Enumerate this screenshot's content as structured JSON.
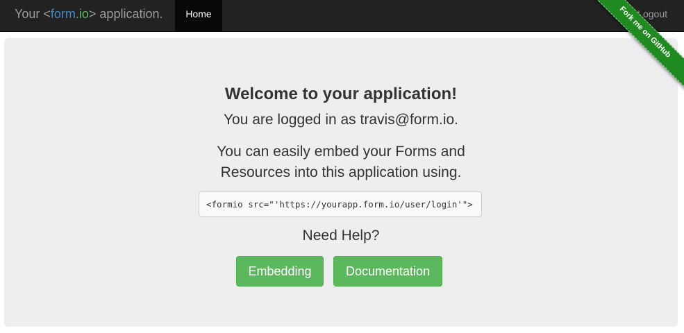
{
  "navbar": {
    "brand_prefix": "Your <",
    "brand_form": "form",
    "brand_io": ".io",
    "brand_suffix": "> application.",
    "home_label": "Home",
    "logout_label": "Logout"
  },
  "ribbon": {
    "label": "Fork me on GitHub"
  },
  "main": {
    "title": "Welcome to your application!",
    "logged_in_text": "You are logged in as travis@form.io.",
    "embed_line1": "You can easily embed your Forms and",
    "embed_line2": "Resources into this application using.",
    "code_snippet": "<formio src=\"'https://yourapp.form.io/user/login'\">",
    "need_help": "Need Help?",
    "embedding_button": "Embedding",
    "documentation_button": "Documentation"
  },
  "colors": {
    "navbar_bg": "#222222",
    "accent_blue": "#428bca",
    "accent_green": "#5cb85c",
    "jumbotron_bg": "#eeeeee",
    "ribbon_green": "#1f8a1f"
  }
}
